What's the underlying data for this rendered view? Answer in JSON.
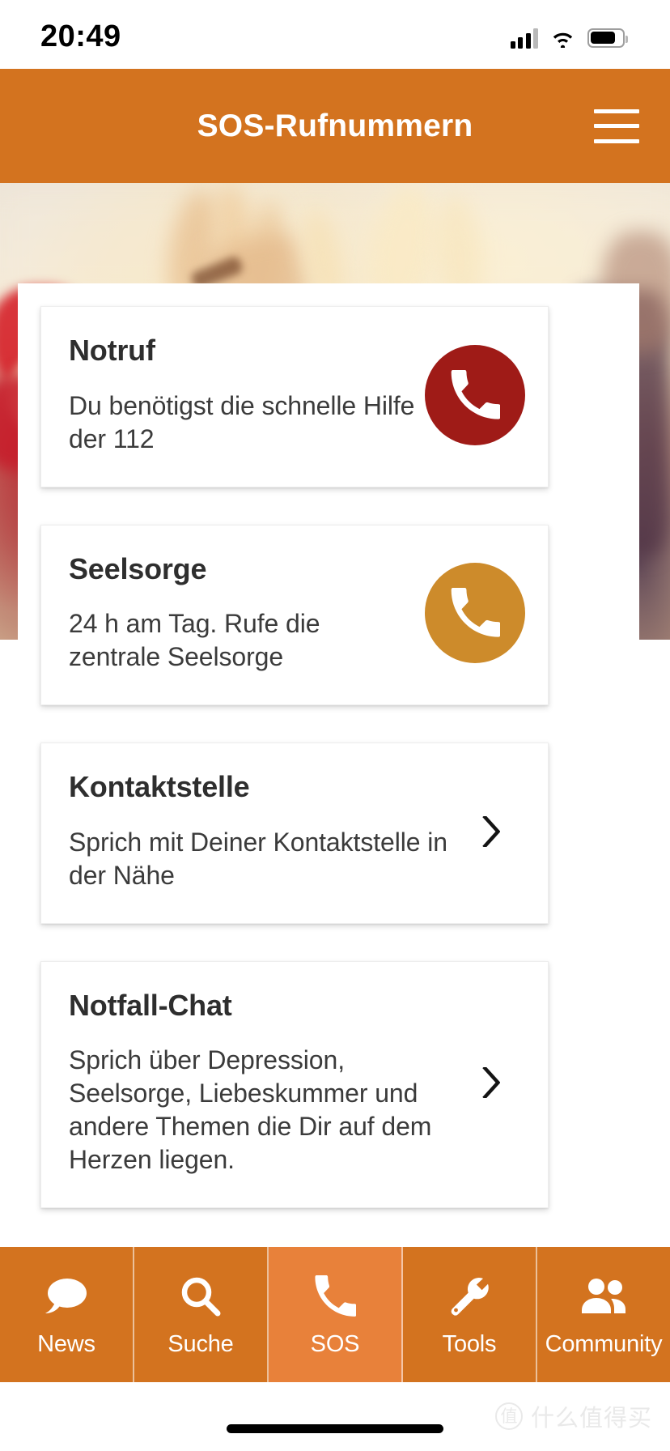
{
  "status_bar": {
    "time": "20:49",
    "cellular_icon": "signal-bars-icon",
    "wifi_icon": "wifi-icon",
    "battery_icon": "battery-icon"
  },
  "header": {
    "title": "SOS-Rufnummern",
    "menu_icon": "hamburger-menu-icon",
    "background_color": "#d3731f",
    "text_color": "#ffffff"
  },
  "cards": [
    {
      "title": "Notruf",
      "description": "Du benötigst die schnelle Hilfe der 112",
      "action": "call",
      "action_icon": "phone-icon",
      "action_color": "#9f1b17"
    },
    {
      "title": "Seelsorge",
      "description": "24 h am Tag. Rufe die zentrale Seelsorge",
      "action": "call",
      "action_icon": "phone-icon",
      "action_color": "#cd8b2b"
    },
    {
      "title": "Kontaktstelle",
      "description": "Sprich mit Deiner Kontaktstelle in der Nähe",
      "action": "navigate",
      "action_icon": "chevron-right-icon",
      "action_color": "#1a1a1a"
    },
    {
      "title": "Notfall-Chat",
      "description": "Sprich über Depression, Seelsorge, Liebeskummer und andere Themen die Dir auf dem Herzen liegen.",
      "action": "navigate",
      "action_icon": "chevron-right-icon",
      "action_color": "#1a1a1a"
    }
  ],
  "tabbar": {
    "active_color": "#e8813a",
    "inactive_color": "#d3731f",
    "items": [
      {
        "label": "News",
        "icon": "chat-bubble-icon",
        "active": false
      },
      {
        "label": "Suche",
        "icon": "search-icon",
        "active": false
      },
      {
        "label": "SOS",
        "icon": "phone-icon",
        "active": true
      },
      {
        "label": "Tools",
        "icon": "wrench-icon",
        "active": false
      },
      {
        "label": "Community",
        "icon": "people-icon",
        "active": false
      }
    ]
  },
  "watermark": {
    "logo_glyph": "值",
    "text": "什么值得买"
  },
  "home_indicator": {
    "icon": "home-indicator-bar"
  }
}
